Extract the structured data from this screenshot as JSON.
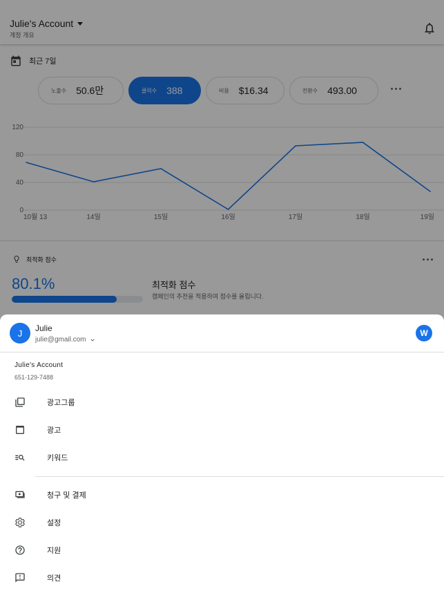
{
  "header": {
    "account_title": "Julie's Account",
    "account_subtitle": "계정 개요"
  },
  "date_range": {
    "label": "최근 7일"
  },
  "metrics": [
    {
      "label": "노출수",
      "value": "50.6만",
      "active": false
    },
    {
      "label": "클릭수",
      "value": "388",
      "active": true
    },
    {
      "label": "비용",
      "value": "$16.34",
      "active": false
    },
    {
      "label": "전환수",
      "value": "493.00",
      "active": false
    }
  ],
  "chart_data": {
    "type": "line",
    "categories": [
      "10월 13",
      "14일",
      "15일",
      "16일",
      "17일",
      "18일",
      "19일"
    ],
    "series": [
      {
        "values": [
          69,
          41,
          60,
          1,
          93,
          98,
          27
        ]
      }
    ],
    "ylim": [
      0,
      120
    ],
    "yticks": [
      0,
      40,
      80,
      120
    ],
    "grid": true,
    "color": "#1a73e8"
  },
  "optimization": {
    "label": "최적화 점수",
    "score": "80.1%",
    "score_fraction": 0.801,
    "title": "최적화 점수",
    "description": "캠페인의 추천을 적용하여 점수를 올립니다."
  },
  "sheet": {
    "user": {
      "initial": "J",
      "name": "Julie",
      "email": "julie@gmail.com"
    },
    "badge": "W",
    "account_name": "Julie's Account",
    "account_id": "651-129-7488",
    "menu_group1": [
      {
        "label": "광고그룹",
        "icon": "ad-groups-icon"
      },
      {
        "label": "광고",
        "icon": "ads-icon"
      },
      {
        "label": "키워드",
        "icon": "keywords-icon"
      }
    ],
    "menu_group2": [
      {
        "label": "청구 및 결제",
        "icon": "billing-icon"
      },
      {
        "label": "설정",
        "icon": "settings-icon"
      },
      {
        "label": "지원",
        "icon": "help-icon"
      },
      {
        "label": "의견",
        "icon": "feedback-icon"
      }
    ]
  },
  "colors": {
    "accent": "#1a73e8",
    "scrim": "rgba(0,0,0,0.40)"
  }
}
